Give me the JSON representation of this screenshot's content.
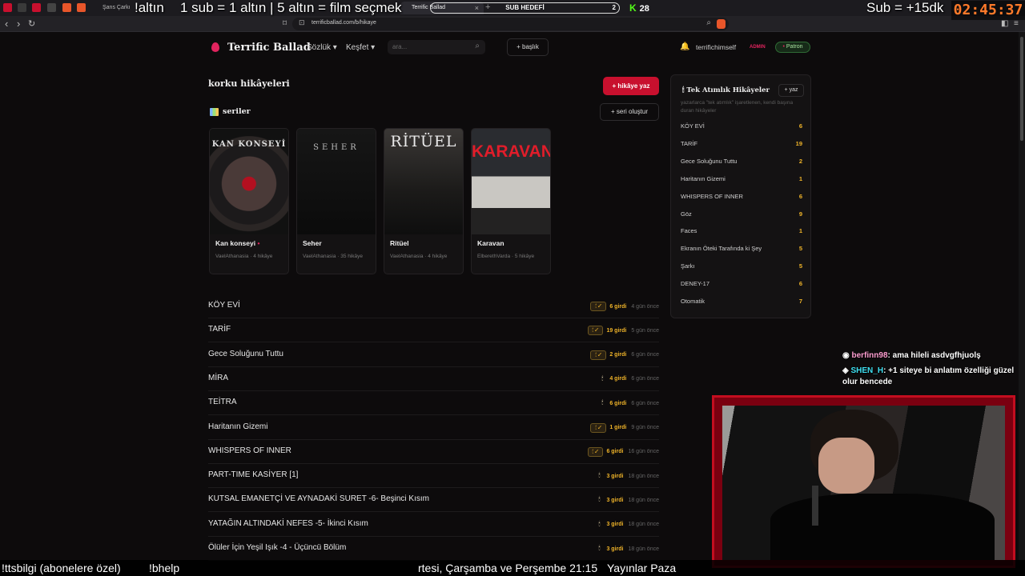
{
  "browser": {
    "tabs": [
      {
        "label": "Şans Çarkı - Ki"
      },
      {
        "label": "Terrific Ballad"
      }
    ],
    "close_glyph": "×",
    "plus_glyph": "+",
    "sub_goal": {
      "label": "SUB HEDEFİ",
      "value": "2"
    },
    "kick_viewers": "28",
    "url": "terrificballad.com/b/hikaye",
    "nav_icons": [
      "back-icon",
      "forward-icon",
      "reload-icon",
      "bookmark-icon",
      "zoom-icon",
      "brave-shield-icon"
    ]
  },
  "overlay": {
    "top_left": "!altın",
    "top_center": "1 sub = 1 altın | 5 altın = film seçmek",
    "top_right": "Sub = +15dk",
    "timer": "02:45:37",
    "chat": [
      {
        "user": "berfinn98",
        "text": ": ama hileli asdvgfhjuolş"
      },
      {
        "user": "SHEN_H",
        "text": ": +1 siteye bi anlatım özelliği güzel olur bencede"
      }
    ],
    "bottom": [
      "!ttsbilgi (abonelere özel)",
      "!bhelp",
      "rtesi, Çarşamba ve Perşembe 21:15",
      "Yayınlar Paza"
    ]
  },
  "header": {
    "site_name": "Terrific Ballad",
    "nav": [
      {
        "label": "Sözlük"
      },
      {
        "label": "Keşfet"
      }
    ],
    "search_placeholder": "ara...",
    "new_topic": "+ başlık",
    "username": "terrifichimself",
    "admin_badge": "ADMIN",
    "patron_badge": "Patron"
  },
  "main": {
    "title": "korku hikâyeleri",
    "write_button": "+ hikâye yaz",
    "series_title": "seriler",
    "create_series": "+ seri oluştur",
    "series": [
      {
        "cover_text": "KAN KONSEYİ",
        "title": "Kan konseyi",
        "meta": "VaelAthanasia · 4 hikâye"
      },
      {
        "cover_text": "SEHER",
        "title": "Seher",
        "meta": "VaelAthanasia · 35 hikâye"
      },
      {
        "cover_text": "RİTÜEL",
        "title": "Ritüel",
        "meta": "VaelAthanasia · 4 hikâye"
      },
      {
        "cover_text": "KARAVAN",
        "title": "Karavan",
        "meta": "ElberethVarda · 5 hikâye"
      }
    ],
    "stories": [
      {
        "title": "KÖY EVİ",
        "badge": "🕯 ✓",
        "entries": "6 girdi",
        "when": "4 gün önce"
      },
      {
        "title": "TARİF",
        "badge": "🕯 ✓",
        "entries": "19 girdi",
        "when": "5 gün önce"
      },
      {
        "title": "Gece Soluğunu Tuttu",
        "badge": "🕯 ✓",
        "entries": "2 girdi",
        "when": "6 gün önce"
      },
      {
        "title": "MİRA",
        "badge": "🕯",
        "entries": "4 girdi",
        "when": "6 gün önce"
      },
      {
        "title": "TEİTRA",
        "badge": "🕯",
        "entries": "6 girdi",
        "when": "6 gün önce"
      },
      {
        "title": "Haritanın Gizemi",
        "badge": "🕯 ✓",
        "entries": "1 girdi",
        "when": "9 gün önce"
      },
      {
        "title": "WHISPERS OF INNER",
        "badge": "🕯 ✓",
        "entries": "6 girdi",
        "when": "16 gün önce"
      },
      {
        "title": "PART-TIME KASİYER [1]",
        "badge": "🕯",
        "entries": "3 girdi",
        "when": "18 gün önce"
      },
      {
        "title": "KUTSAL EMANETÇİ VE AYNADAKİ SURET -6- Beşinci Kısım",
        "badge": "🕯",
        "entries": "3 girdi",
        "when": "18 gün önce"
      },
      {
        "title": "YATAĞIN ALTINDAKİ NEFES -5- İkinci Kısım",
        "badge": "🕯",
        "entries": "3 girdi",
        "when": "18 gün önce"
      },
      {
        "title": "Ölüler İçin Yeşil Işık -4 - Üçüncü Bölüm",
        "badge": "🕯",
        "entries": "3 girdi",
        "when": "18 gün önce"
      }
    ]
  },
  "panel": {
    "title": "Tek Atımlık Hikâyeler",
    "write": "+ yaz",
    "description": "yazarlarca \"tek atımlık\" işaretlenen, kendi başına duran hikâyeler",
    "items": [
      {
        "name": "KÖY EVİ",
        "count": "6"
      },
      {
        "name": "TARİF",
        "count": "19"
      },
      {
        "name": "Gece Soluğunu Tuttu",
        "count": "2"
      },
      {
        "name": "Haritanın Gizemi",
        "count": "1"
      },
      {
        "name": "WHISPERS OF INNER",
        "count": "6"
      },
      {
        "name": "Göz",
        "count": "9"
      },
      {
        "name": "Faces",
        "count": "1"
      },
      {
        "name": "Ekranın Öteki Tarafında ki Şey",
        "count": "5"
      },
      {
        "name": "Şarkı",
        "count": "5"
      },
      {
        "name": "DENEY-17",
        "count": "6"
      },
      {
        "name": "Otomatik",
        "count": "7"
      }
    ]
  },
  "colors": {
    "accent": "#c8102e",
    "gold": "#f0b429",
    "timer": "#ff7a2a"
  }
}
